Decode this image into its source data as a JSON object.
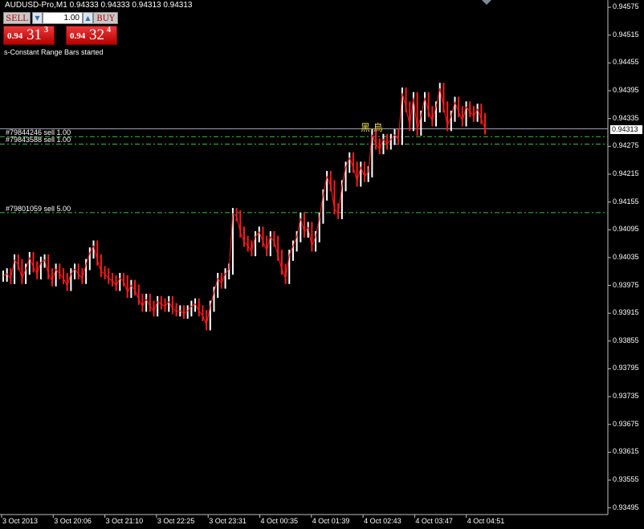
{
  "window": {
    "title": "AUDUSD-Pro,M1  0.94333 0.94333 0.94313 0.94313"
  },
  "trade_panel": {
    "sell_label": "SELL",
    "buy_label": "BUY",
    "lot_value": "1.00",
    "sell_price_prefix": "0.94",
    "sell_price_big": "31",
    "sell_price_sup": "3",
    "buy_price_prefix": "0.94",
    "buy_price_big": "32",
    "buy_price_sup": "4"
  },
  "status_text": "s-Constant Range Bars started",
  "orders": [
    {
      "label": "#79844246 sell 1.00",
      "price": 0.94296
    },
    {
      "label": "#79843588 sell 1.00",
      "price": 0.9428
    },
    {
      "label": "#79801059 sell 5.00",
      "price": 0.94132
    }
  ],
  "annotation": "黑 鳥",
  "current_price_label": "0.94313",
  "colors": {
    "up": "#ffffff",
    "down": "#ff1a1a",
    "order_line": "#3fbf3f",
    "grid": "#c0c0c0"
  },
  "chart_data": {
    "type": "line",
    "title": "AUDUSD-Pro,M1",
    "ylim": [
      0.93491,
      0.9457
    ],
    "y_ticks": [
      "0.94575",
      "0.94515",
      "0.94455",
      "0.94395",
      "0.94335",
      "0.94275",
      "0.94215",
      "0.94155",
      "0.94095",
      "0.94035",
      "0.93975",
      "0.93915",
      "0.93855",
      "0.93795",
      "0.93735",
      "0.93675",
      "0.93615",
      "0.93555",
      "0.93495"
    ],
    "x_ticks": [
      "3 Oct 2013",
      "3 Oct 20:06",
      "3 Oct 21:10",
      "3 Oct 22:25",
      "3 Oct 23:31",
      "4 Oct 00:35",
      "4 Oct 01:39",
      "4 Oct 02:43",
      "4 Oct 03:47",
      "4 Oct 04:51"
    ],
    "current_price": 0.94313,
    "series": [
      {
        "values": [
          0.93995,
          0.94,
          0.9399,
          0.9403,
          0.9402,
          0.9399,
          0.9401,
          0.94035,
          0.94015,
          0.94,
          0.94025,
          0.9403,
          0.94,
          0.93985,
          0.9401,
          0.94,
          0.9399,
          0.93975,
          0.94,
          0.9401,
          0.94,
          0.9399,
          0.9402,
          0.94045,
          0.9406,
          0.9403,
          0.94005,
          0.94,
          0.9399,
          0.93985,
          0.93975,
          0.9399,
          0.93985,
          0.9396,
          0.93975,
          0.93965,
          0.93945,
          0.9393,
          0.93945,
          0.9393,
          0.9392,
          0.9394,
          0.93935,
          0.9393,
          0.9394,
          0.93925,
          0.9392,
          0.9392,
          0.93915,
          0.9392,
          0.9393,
          0.93935,
          0.9392,
          0.9391,
          0.9389,
          0.9393,
          0.9396,
          0.9399,
          0.9398,
          0.94,
          0.9401,
          0.9413,
          0.94125,
          0.9409,
          0.9407,
          0.9406,
          0.9405,
          0.9408,
          0.9409,
          0.9407,
          0.9405,
          0.9408,
          0.9407,
          0.9404,
          0.9401,
          0.9399,
          0.9404,
          0.9406,
          0.9408,
          0.9412,
          0.9409,
          0.941,
          0.9406,
          0.9408,
          0.9412,
          0.9417,
          0.9421,
          0.9419,
          0.9414,
          0.9413,
          0.9419,
          0.9423,
          0.9425,
          0.9423,
          0.942,
          0.9423,
          0.9421,
          0.9422,
          0.943,
          0.9428,
          0.9427,
          0.9429,
          0.9428,
          0.9429,
          0.943,
          0.9429,
          0.9439,
          0.9436,
          0.9432,
          0.9438,
          0.9431,
          0.9434,
          0.9438,
          0.9435,
          0.9433,
          0.9436,
          0.944,
          0.9436,
          0.9432,
          0.9434,
          0.9437,
          0.9435,
          0.9433,
          0.9436,
          0.9435,
          0.9434,
          0.94355,
          0.94335,
          0.94313
        ]
      }
    ]
  }
}
